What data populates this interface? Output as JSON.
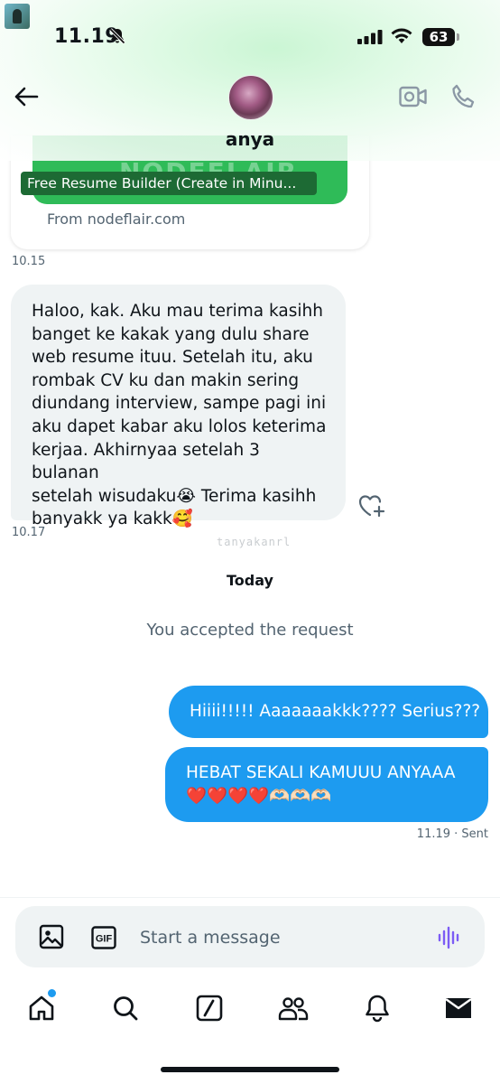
{
  "status_bar": {
    "time": "11.19",
    "battery": "63"
  },
  "header": {
    "contact_name": "anya"
  },
  "link_card": {
    "banner_brand": "NODEFLAIR",
    "title": "Free Resume Builder (Create in Minu...",
    "source": "From nodeflair.com",
    "time": "10.15"
  },
  "received_message": {
    "lines": [
      "Haloo, kak. Aku mau terima kasihh",
      "banget ke kakak yang dulu share",
      "web resume ituu. Setelah itu, aku",
      "rombak CV ku dan makin sering",
      "diundang interview, sampe pagi ini",
      "aku dapet kabar aku lolos keterima",
      "kerjaa. Akhirnyaa setelah 3 bulanan",
      "setelah wisudaku😭 Terima kasihh",
      "banyakk ya kakk🥰"
    ],
    "time": "10.17"
  },
  "watermark": "tanyakanrl",
  "date_divider": "Today",
  "system_message": "You accepted the request",
  "sent_messages": [
    {
      "lines": [
        "Hiiii!!!!! Aaaaaaakkk???? Serius???"
      ]
    },
    {
      "lines": [
        "HEBAT SEKALI KAMUUU ANYAAA",
        "❤️❤️❤️❤️🫶🏻🫶🏻🫶🏻"
      ]
    }
  ],
  "sent_meta": "11.19 · Sent",
  "composer": {
    "placeholder": "Start a message",
    "gif_label": "GIF"
  },
  "nav": {
    "items": [
      "home-icon",
      "search-icon",
      "grok-icon",
      "communities-icon",
      "notifications-icon",
      "messages-icon"
    ],
    "home_has_notification": true
  },
  "colors": {
    "accent": "#1d9bf0",
    "link_banner": "#2fbb58",
    "received_bubble": "#eff3f4"
  }
}
